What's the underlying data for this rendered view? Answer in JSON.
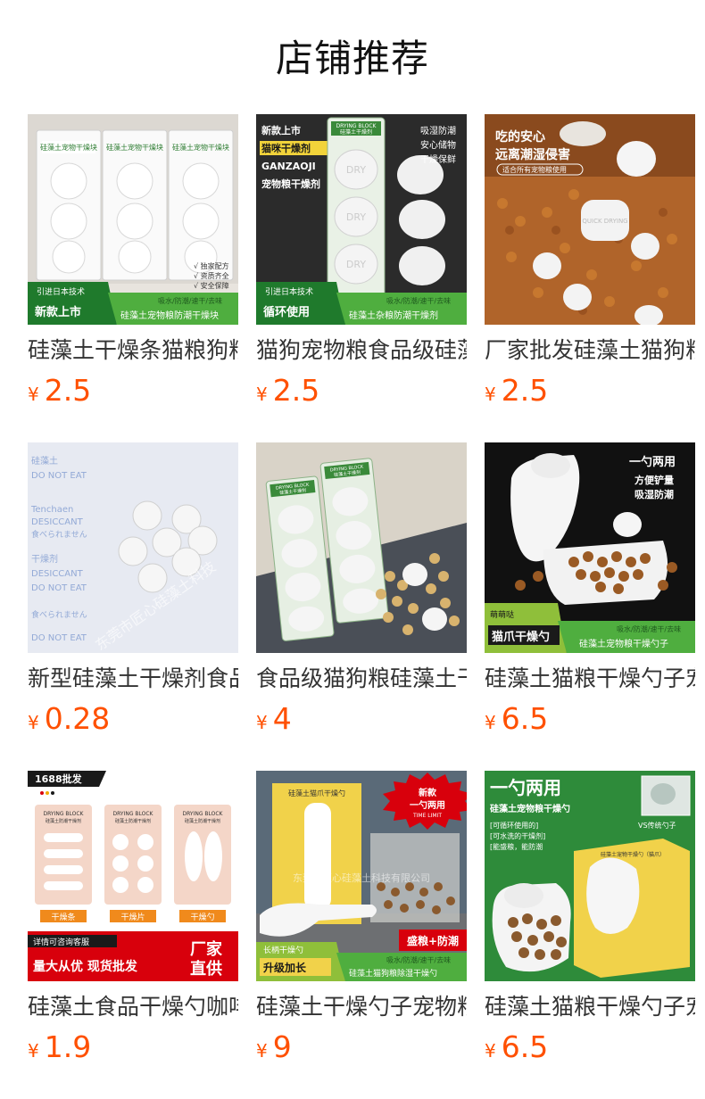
{
  "page": {
    "title": "店铺推荐"
  },
  "colors": {
    "price": "#ff5000",
    "title": "#333333",
    "brand_green": "#2e8b3a",
    "banner_red": "#d8000c"
  },
  "products": [
    {
      "title": "硅藻土干燥条猫粮狗粮",
      "currency": "¥",
      "price": "2.5",
      "image": {
        "tag_top": "引进日本技术",
        "tag_main": "新款上市",
        "tag_right_top": "吸水/防潮/速干/去味",
        "tag_right_main": "硅藻土宠物粮防潮干燥块",
        "features": [
          "√ 独家配方",
          "√ 资质齐全",
          "√ 安全保障"
        ],
        "pack_label": "硅藻土宠物干燥块"
      }
    },
    {
      "title": "猫狗宠物粮食品级硅藻",
      "currency": "¥",
      "price": "2.5",
      "image": {
        "headline_1": "新款上市",
        "headline_2": "猫咪干燥剂",
        "headline_3": "GANZAOJI",
        "headline_4": "宠物粮干燥剂",
        "side_1": "吸湿防潮",
        "side_2": "安心储物",
        "side_3": "干燥保鲜",
        "pack_top": "DRYING BLOCK",
        "pack_label": "硅藻土干燥剂",
        "dry": "DRY",
        "tag_top": "引进日本技术",
        "tag_main": "循环使用",
        "tag_right_top": "吸水/防潮/速干/去味",
        "tag_right_main": "硅藻土杂粮防潮干燥剂"
      }
    },
    {
      "title": "厂家批发硅藻土猫狗粮",
      "currency": "¥",
      "price": "2.5",
      "image": {
        "headline_1": "吃的安心",
        "headline_2": "远离潮湿侵害",
        "sub": "适合所有宠物粮使用",
        "block_text": "QUICK DRYING"
      }
    },
    {
      "title": "新型硅藻土干燥剂食品",
      "currency": "¥",
      "price": "0.28",
      "image": {
        "paper_lines": [
          "硅藻土",
          "DESICCANT",
          "DO NOT EAT",
          "Tenchaen",
          "食べられません",
          "干燥剂"
        ],
        "watermark": "东莞市匠心硅藻土科技"
      }
    },
    {
      "title": "食品级猫狗粮硅藻土干",
      "currency": "¥",
      "price": "4",
      "image": {
        "pack_top": "DRYING BLOCK",
        "pack_label": "硅藻土干燥剂"
      }
    },
    {
      "title": "硅藻土猫粮干燥勺子宠",
      "currency": "¥",
      "price": "6.5",
      "image": {
        "headline_1": "一勺两用",
        "headline_2": "方便铲量",
        "headline_3": "吸湿防潮",
        "tag_top": "萌萌哒",
        "tag_main": "猫爪干燥勺",
        "tag_right_top": "吸水/防潮/速干/去味",
        "tag_right_main": "硅藻土宠物粮干燥勺子"
      }
    },
    {
      "title": "硅藻土食品干燥勺咖啡",
      "currency": "¥",
      "price": "1.9",
      "image": {
        "badge": "1688批发",
        "pack_top": "DRYING BLOCK",
        "pack_label": "硅藻土防潮干燥剂",
        "labels": [
          "干燥条",
          "干燥片",
          "干燥勺"
        ],
        "banner_small": "详情可咨询客服",
        "banner_main": "量大从优 现货批发",
        "banner_right_1": "厂家",
        "banner_right_2": "直供"
      }
    },
    {
      "title": "硅藻土干燥勺子宠物粮",
      "currency": "¥",
      "price": "9",
      "image": {
        "box_title": "硅藻土猫爪干燥勺",
        "star_1": "新款",
        "star_2": "一勺两用",
        "star_3": "TIME LIMIT",
        "watermark": "东莞市匠心硅藻土科技有限公司",
        "tag_top": "长柄干燥勺",
        "tag_main": "升级加长",
        "tag_right_top": "盛粮+防潮",
        "tag_right_sub": "吸水/防潮/速干/去味",
        "tag_right_main": "硅藻土猫狗粮除湿干燥勺"
      }
    },
    {
      "title": "硅藻土猫粮干燥勺子宠",
      "currency": "¥",
      "price": "6.5",
      "image": {
        "headline_1": "一勺两用",
        "headline_2": "硅藻土宠物粮干燥勺",
        "notes": [
          "[可循环使用的]",
          "[可水洗的干燥剂]",
          "[能盛粮，能防潮"
        ],
        "vs": "VS传统勺子",
        "box_title": "硅藻土宠物干燥勺（猫爪）"
      }
    }
  ]
}
